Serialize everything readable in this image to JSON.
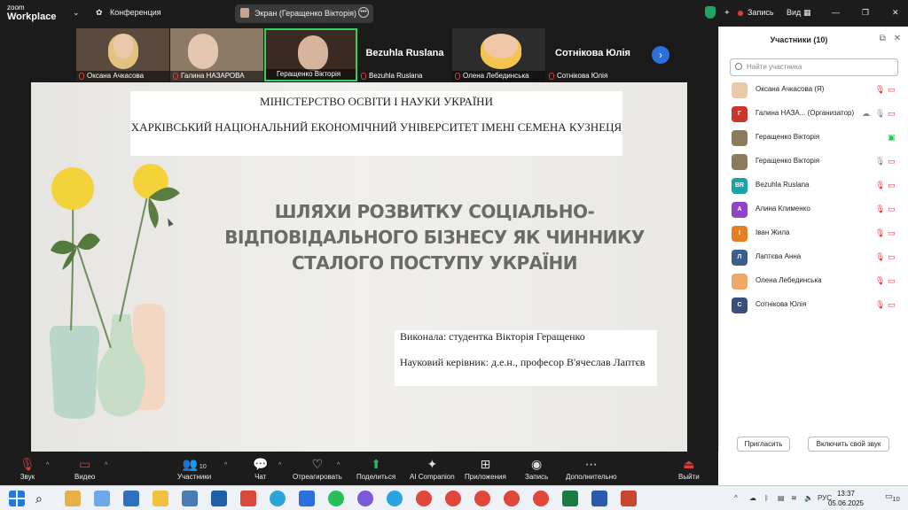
{
  "app": {
    "logo_line1": "zoom",
    "logo_line2": "Workplace",
    "meeting_menu": "Конференция",
    "share_title": "Экран (Геращенко Вікторія)",
    "record_label": "Запись",
    "view_label": "Вид"
  },
  "gallery": {
    "tiles": [
      {
        "name": "Оксана Ачкасова",
        "face_color": "#e9c9a9",
        "hair": "#e2c27e"
      },
      {
        "name": "Галина НАЗАРОВА",
        "face_color": "#e5c6b0",
        "hair": "#bdbdbd"
      },
      {
        "name": "Геращенко Вікторія",
        "face_color": "#d7b49c",
        "hair": "#4a3328"
      },
      {
        "name": "Bezuhla Ruslana",
        "big": "Bezuhla Ruslana"
      },
      {
        "name": "Олена Лебединська",
        "face_color": "#f0c7a9",
        "hair": "#f4c54e"
      },
      {
        "name": "Сотнікова Юлія",
        "big": "Сотнікова Юлія"
      }
    ]
  },
  "slide": {
    "ministry": "МІНІСТЕРСТВО ОСВІТИ І НАУКИ УКРАЇНИ",
    "university": "ХАРКІВСЬКИЙ НАЦІОНАЛЬНИЙ ЕКОНОМІЧНИЙ УНІВЕРСИТЕТ ІМЕНІ СЕМЕНА КУЗНЕЦЯ",
    "title_line1": "ШЛЯХИ РОЗВИТКУ СОЦІАЛЬНО-",
    "title_line2": "ВІДПОВІДАЛЬНОГО БІЗНЕСУ ЯК ЧИННИКУ",
    "title_line3": "СТАЛОГО ПОСТУПУ УКРАЇНИ",
    "author": "Виконала: студентка Вікторія Геращенко",
    "supervisor": "Науковий керівник: д.е.н., професор В'ячеслав Лаптєв"
  },
  "controls": {
    "audio": "Звук",
    "video": "Видео",
    "participants": "Участники",
    "participants_count": "10",
    "chat": "Чат",
    "react": "Отреагировать",
    "share": "Поделиться",
    "ai": "AI Companion",
    "apps": "Приложения",
    "record": "Запись",
    "more": "Дополнительно",
    "leave": "Выйти"
  },
  "panel": {
    "title": "Участники (10)",
    "search_placeholder": "Найти участника",
    "participants": [
      {
        "name": "Оксана Ачкасова (Я)",
        "initial": "",
        "color": "#e9c9a9"
      },
      {
        "name": "Галина НАЗА... (Организатор)",
        "initial": "Г",
        "color": "#c9372c"
      },
      {
        "name": "Геращенко Вікторія",
        "initial": "",
        "color": "#8a7b5e"
      },
      {
        "name": "Геращенко Вікторія",
        "initial": "",
        "color": "#8a7b5e"
      },
      {
        "name": "Bezuhla Ruslana",
        "initial": "BR",
        "color": "#1aa3a3"
      },
      {
        "name": "Алина Клименко",
        "initial": "A",
        "color": "#8e44c7"
      },
      {
        "name": "Іван Жила",
        "initial": "I",
        "color": "#e67e22"
      },
      {
        "name": "Лаптєва Анна",
        "initial": "Л",
        "color": "#3b5f8a"
      },
      {
        "name": "Олена Лебединська",
        "initial": "",
        "color": "#f0a868"
      },
      {
        "name": "Сотнікова Юлія",
        "initial": "С",
        "color": "#3b4f7a"
      }
    ],
    "invite": "Пригласить",
    "unmute": "Включить свой звук"
  },
  "taskbar": {
    "lang": "РУС",
    "time": "13:37",
    "date": "05.06.2025",
    "notif": "10"
  }
}
